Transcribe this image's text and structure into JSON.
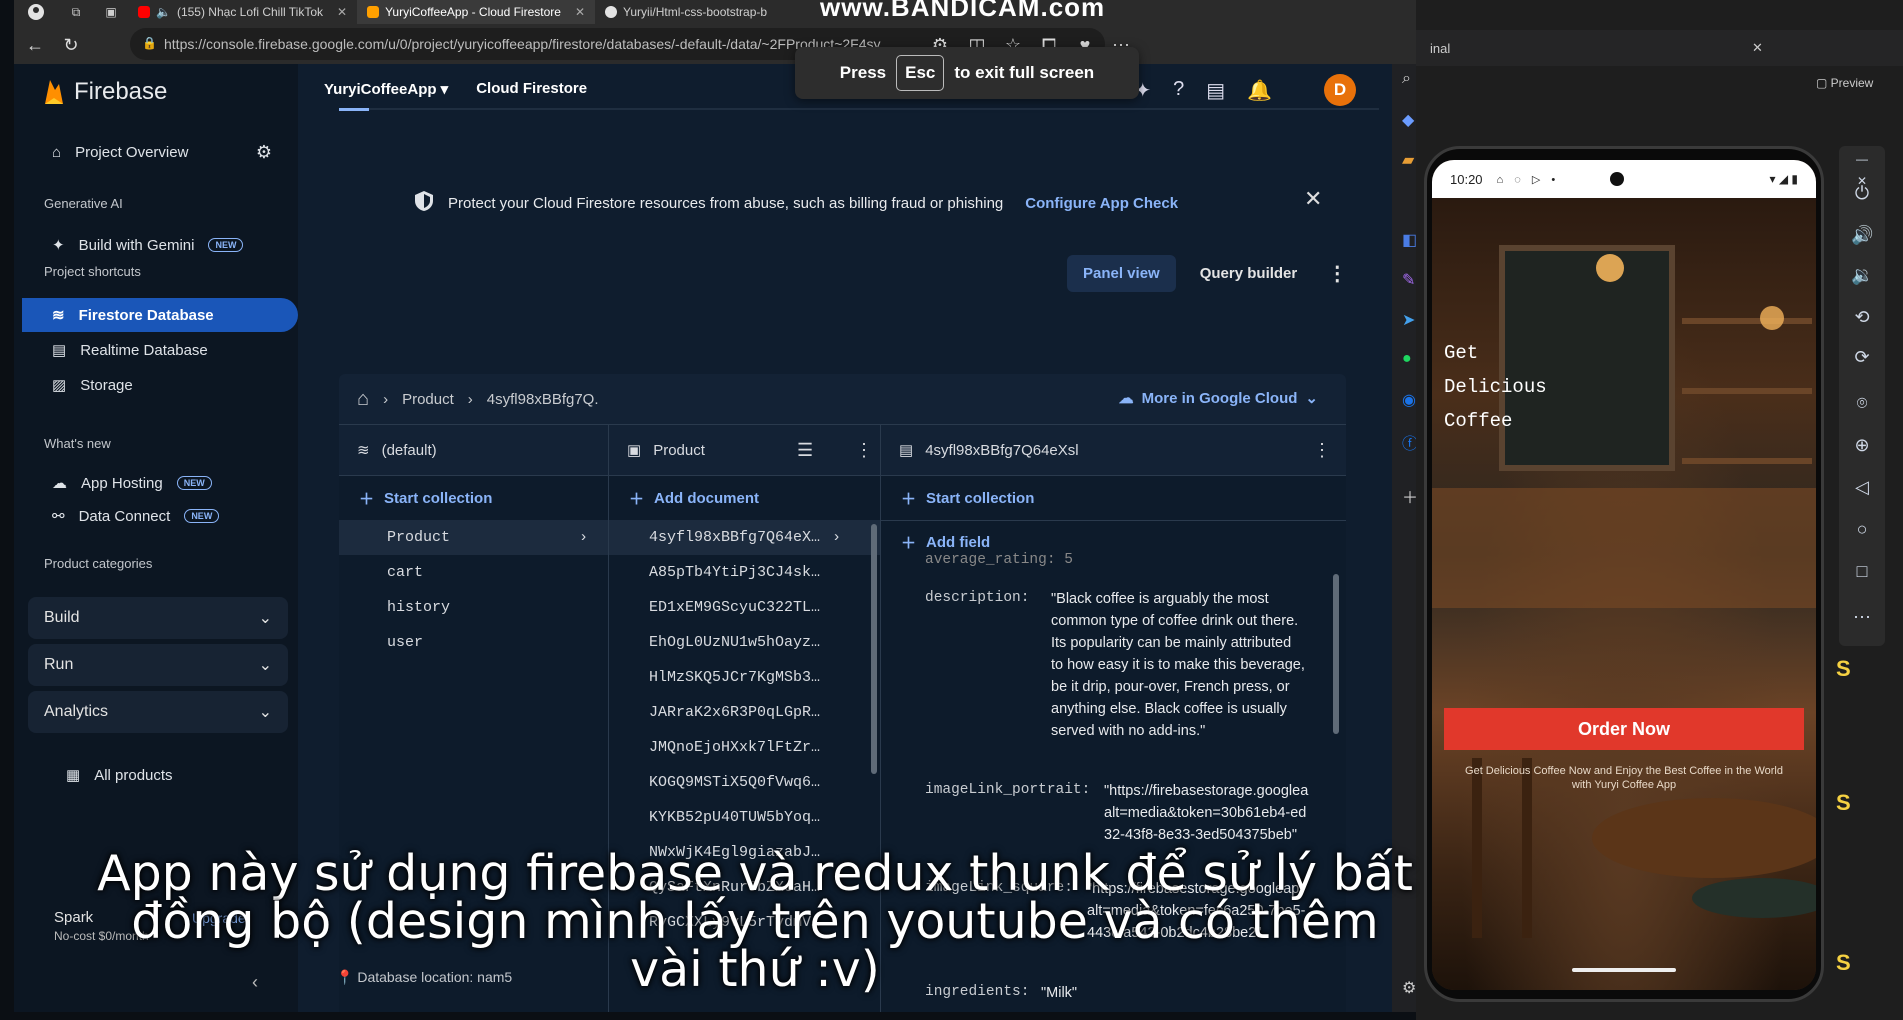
{
  "watermark": "www.BANDICAM.com",
  "browser": {
    "tabs": [
      {
        "title": "(155) Nhạc Lofi Chill TikTok"
      },
      {
        "title": "YuryiCoffeeApp - Cloud Firestore"
      },
      {
        "title": "Yuryii/Html-css-bootstrap-b"
      }
    ],
    "url": "https://console.firebase.google.com/u/0/project/yuryicoffeeapp/firestore/databases/-default-/data/~2FProduct~2F4sy...",
    "fullscreen_press": "Press",
    "fullscreen_key": "Esc",
    "fullscreen_rest": "to exit full screen"
  },
  "firebase": {
    "brand": "Firebase",
    "project_name": "YuryiCoffeeApp",
    "product_name": "Cloud Firestore",
    "avatar_letter": "D",
    "sidebar": {
      "project_overview": "Project Overview",
      "section_genai": "Generative AI",
      "build_with_gemini": "Build with Gemini",
      "new_badge": "NEW",
      "section_shortcuts": "Project shortcuts",
      "firestore": "Firestore Database",
      "realtime": "Realtime Database",
      "storage": "Storage",
      "section_whats_new": "What's new",
      "app_hosting": "App Hosting",
      "data_connect": "Data Connect",
      "section_categories": "Product categories",
      "build": "Build",
      "run": "Run",
      "analytics": "Analytics",
      "all_products": "All products",
      "plan_name": "Spark",
      "plan_desc": "No-cost $0/month",
      "upgrade": "Upgrade"
    },
    "banner": {
      "text": "Protect your Cloud Firestore resources from abuse, such as billing fraud or phishing",
      "link": "Configure App Check"
    },
    "view_toggle": {
      "panel": "Panel view",
      "query": "Query builder"
    },
    "breadcrumb": {
      "collection": "Product",
      "document": "4syfl98xBBfg7Q.",
      "more": "More in Google Cloud"
    },
    "col1": {
      "title": "(default)",
      "action": "Start collection",
      "items": [
        "Product",
        "cart",
        "history",
        "user"
      ]
    },
    "col2": {
      "title": "Product",
      "action": "Add document",
      "items": [
        "4syfl98xBBfg7Q64eX…",
        "A85pTb4YtiPj3CJ4sk…",
        "ED1xEM9GScyuC322TL…",
        "EhOgL0UzNU1w5hOayz…",
        "HlMzSKQ5JCr7KgMSb3…",
        "JARraK2x6R3P0qLGpR…",
        "JMQnoEjoHXxk7lFtZr…",
        "KOGQ9MSTiX5Q0fVwq6…",
        "KYKB52pU40TUW5bYoq…",
        "NWxWjK4Egl9giazabJ…",
        "QySaFtXnRurJbZXcaH…",
        "RyGCXXLy9vL5rTvdmV…"
      ]
    },
    "col3": {
      "title": "4syfl98xBBfg7Q64eXsl",
      "action1": "Start collection",
      "action2": "Add field",
      "partial_field": "average_rating: 5",
      "description_key": "description:",
      "description_val": "\"Black coffee is arguably the most common type of coffee drink out there. Its popularity can be mainly attributed to how easy it is to make this beverage, be it drip, pour-over, French press, or anything else. Black coffee is usually served with no add-ins.\"",
      "portrait_key": "imageLink_portrait:",
      "portrait_val": "\"https://firebasestorage.googlea alt=media&token=30b61eb4-ed32-43f8-8e33-3ed504375beb\"",
      "square_key": "imageLink_square:",
      "square_val": "\"https://firebasestorage.googleapi alt=media&token=fec6a250-7be5-443c-a543-0b2dc4b28be2\"",
      "ingredients_key": "ingredients:",
      "ingredients_val": "\"Milk\""
    },
    "db_location": "Database location: nam5"
  },
  "emulator": {
    "time": "10:20",
    "hero": [
      "Get",
      "Delicious",
      "Coffee"
    ],
    "order_button": "Order Now",
    "subtitle": "Get Delicious Coffee Now and Enjoy the Best Coffee in the World with Yuryi Coffee App"
  },
  "vscode": {
    "tab_title": "inal",
    "preview": "Preview"
  },
  "caption": "App này sử dụng firebase và redux thunk để sử lý bất đồng bộ (design mình lấy trên youtube và có thêm vài thứ :v)",
  "colors": {
    "firebase_accent": "#1a56b8",
    "link": "#8ab4f8",
    "order_button": "#e1382b",
    "avatar": "#e8710a"
  }
}
